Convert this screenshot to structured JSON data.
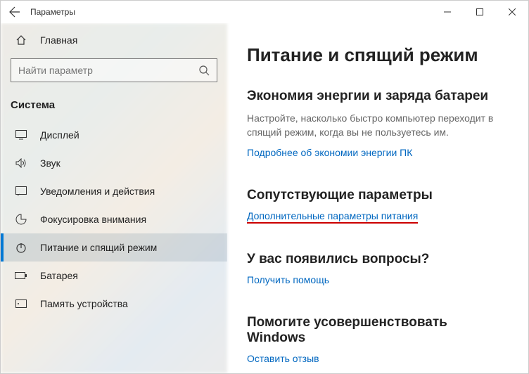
{
  "titlebar": {
    "title": "Параметры"
  },
  "sidebar": {
    "home": "Главная",
    "search_placeholder": "Найти параметр",
    "group": "Система",
    "items": [
      {
        "label": "Дисплей"
      },
      {
        "label": "Звук"
      },
      {
        "label": "Уведомления и действия"
      },
      {
        "label": "Фокусировка внимания"
      },
      {
        "label": "Питание и спящий режим"
      },
      {
        "label": "Батарея"
      },
      {
        "label": "Память устройства"
      }
    ]
  },
  "content": {
    "heading": "Питание и спящий режим",
    "energy": {
      "title": "Экономия энергии и заряда батареи",
      "desc": "Настройте, насколько быстро компьютер переходит в спящий режим, когда вы не пользуетесь им.",
      "link": "Подробнее об экономии энергии ПК"
    },
    "related": {
      "title": "Сопутствующие параметры",
      "link": "Дополнительные параметры питания"
    },
    "help": {
      "title": "У вас появились вопросы?",
      "link": "Получить помощь"
    },
    "improve": {
      "title": "Помогите усовершенствовать Windows",
      "link": "Оставить отзыв"
    }
  }
}
